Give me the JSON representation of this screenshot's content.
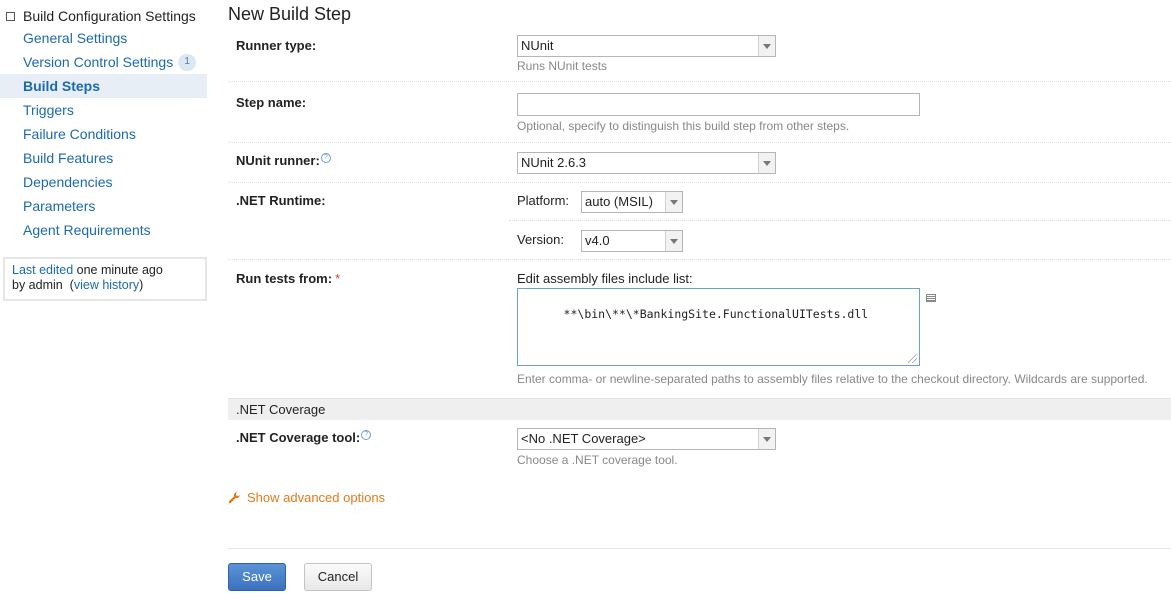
{
  "sidebar": {
    "header": "Build Configuration Settings",
    "items": [
      {
        "label": "General Settings"
      },
      {
        "label": "Version Control Settings",
        "badge": "1"
      },
      {
        "label": "Build Steps",
        "active": true
      },
      {
        "label": "Triggers"
      },
      {
        "label": "Failure Conditions"
      },
      {
        "label": "Build Features"
      },
      {
        "label": "Dependencies"
      },
      {
        "label": "Parameters"
      },
      {
        "label": "Agent Requirements"
      }
    ],
    "last_edited": {
      "link_label": "Last edited",
      "time": "one minute ago",
      "by": "by admin",
      "history_link": "view history"
    }
  },
  "main": {
    "title": "New Build Step",
    "runner_type": {
      "label": "Runner type:",
      "value": "NUnit",
      "note": "Runs NUnit tests"
    },
    "step_name": {
      "label": "Step name:",
      "value": "",
      "note": "Optional, specify to distinguish this build step from other steps."
    },
    "nunit_runner": {
      "label": "NUnit runner:",
      "value": "NUnit 2.6.3"
    },
    "net_runtime": {
      "label": ".NET Runtime:",
      "platform_label": "Platform:",
      "platform_value": "auto (MSIL)",
      "version_label": "Version:",
      "version_value": "v4.0"
    },
    "run_tests_from": {
      "label": "Run tests from:",
      "required_mark": "*",
      "list_label": "Edit assembly files include list:",
      "value": "**\\bin\\**\\*BankingSite.FunctionalUITests.dll",
      "note": "Enter comma- or newline-separated paths to assembly files relative to the checkout directory. Wildcards are supported."
    },
    "coverage_section": ".NET Coverage",
    "coverage_tool": {
      "label": ".NET Coverage tool:",
      "value": "<No .NET Coverage>",
      "note": "Choose a .NET coverage tool."
    },
    "advanced_link": "Show advanced options",
    "save_label": "Save",
    "cancel_label": "Cancel"
  },
  "colors": {
    "link": "#1b6aac",
    "accent_orange": "#e37a1a",
    "primary_button": "#3a72be"
  }
}
